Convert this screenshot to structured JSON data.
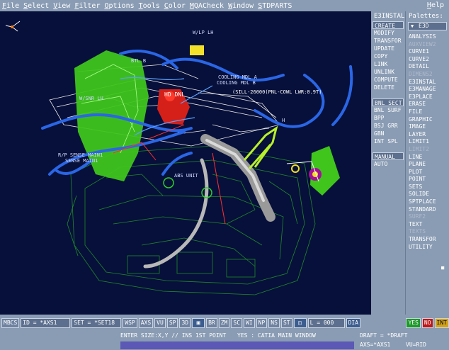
{
  "menubar": {
    "items": [
      "File",
      "Select",
      "View",
      "Filter",
      "Options",
      "Tools",
      "Color",
      "MQACheck",
      "Window",
      "STDPARTS"
    ],
    "help": "Help"
  },
  "viewport": {
    "labels": {
      "lp_lh": "W/LP LH",
      "bt": "BTL B",
      "cooling_a": "COOLING MDL A",
      "cooling_b": "COOLING MDL B",
      "note": "(SILL-26000(PNL-COWL LWR:0.9T)",
      "hd_dnl": "HD DNL",
      "snr": "W/SNR LH",
      "sense1": "R/P SENSE MAIN1",
      "sense2": "SENSE MAIN1",
      "abs": "ABS UNIT",
      "h": "H"
    }
  },
  "commands": {
    "title": "E3INSTAL",
    "group1": [
      "CREATE",
      "MODIFY",
      "TRANSFOR",
      "UPDATE",
      "COPY",
      "LINK",
      "UNLINK",
      "COMPUTE",
      "DELETE"
    ],
    "group2": [
      "BNL SECT",
      "BNL SURF",
      "BPP",
      "BSJ GRR",
      "GBN",
      "INT SPL"
    ],
    "group3": [
      "MANUAL",
      "AUTO"
    ]
  },
  "palettes": {
    "title": "Palettes:",
    "selected": "E3D",
    "items": [
      {
        "label": "ANALYSIS",
        "dim": false
      },
      {
        "label": "AUXVIEW2",
        "dim": true
      },
      {
        "label": "CURVE1",
        "dim": false
      },
      {
        "label": "CURVE2",
        "dim": false
      },
      {
        "label": "DETAIL",
        "dim": false
      },
      {
        "label": "DIMENS2",
        "dim": true
      },
      {
        "label": "E3INSTAL",
        "dim": false
      },
      {
        "label": "E3MANAGE",
        "dim": false
      },
      {
        "label": "E3PLACE",
        "dim": false
      },
      {
        "label": "ERASE",
        "dim": false
      },
      {
        "label": "FILE",
        "dim": false
      },
      {
        "label": "GRAPHIC",
        "dim": false
      },
      {
        "label": "IMAGE",
        "dim": false
      },
      {
        "label": "LAYER",
        "dim": false
      },
      {
        "label": "LIMIT1",
        "dim": false
      },
      {
        "label": "LIMIT2",
        "dim": true
      },
      {
        "label": "LINE",
        "dim": false
      },
      {
        "label": "PLANE",
        "dim": false
      },
      {
        "label": "PLOT",
        "dim": false
      },
      {
        "label": "POINT",
        "dim": false
      },
      {
        "label": "SETS",
        "dim": false
      },
      {
        "label": "SOLIDE",
        "dim": false
      },
      {
        "label": "SPTPLACE",
        "dim": false
      },
      {
        "label": "STANDARD",
        "dim": false
      },
      {
        "label": "SURF2",
        "dim": true
      },
      {
        "label": "TEXT",
        "dim": false
      },
      {
        "label": "TEXTS",
        "dim": true
      },
      {
        "label": "TRANSFOR",
        "dim": false
      },
      {
        "label": "UTILITY",
        "dim": false
      }
    ]
  },
  "toolbar": {
    "mbcs": "MBCS",
    "id_field": "ID = *AXS1",
    "set_field": "SET = *SET18",
    "buttons": [
      "WSP",
      "AXS",
      "VU",
      "SP",
      "3D"
    ],
    "buttons2": [
      "BR",
      "ZM",
      "SC",
      "WI",
      "NP",
      "NS",
      "ST"
    ],
    "l_field": "L = 000",
    "dia": "DIA",
    "yes": "YES",
    "no": "NO",
    "int": "INT"
  },
  "status": {
    "prompt": "ENTER SIZE:X,Y // INS 1ST POINT",
    "yes_info": "YES : CATIA MAIN WINDOW",
    "draft": "DRAFT = *DRAFT",
    "axs": "AXS=*AXS1",
    "vu": "VU=RID"
  }
}
